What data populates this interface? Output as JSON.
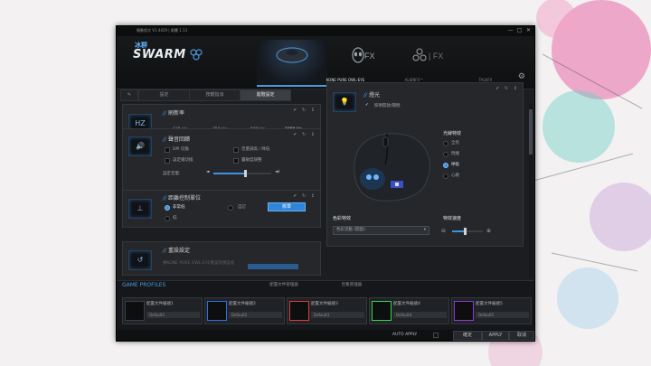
{
  "window": {
    "title": "驅動程式 V1.4429 | 韌體 1.13",
    "controls": [
      "—",
      "□",
      "✕"
    ]
  },
  "brand": {
    "cn": "冰群",
    "name": "SWARM"
  },
  "devices": [
    {
      "label": "KONE PURE OWL-EYE"
    },
    {
      "label": "ALIENFX™"
    },
    {
      "label": "TALKFX"
    }
  ],
  "tabs": [
    "設定",
    "按鍵指派",
    "進階設定"
  ],
  "panels": {
    "polling": {
      "title": "刷新率",
      "options": [
        "125 Hz",
        "250 Hz",
        "500 Hz",
        "1000 Hz"
      ],
      "selected": "1000 Hz",
      "icon_text": "HZ"
    },
    "sound": {
      "title": "聲音回饋",
      "options": [
        "DPI 切換",
        "音量調高 / 降低",
        "設定檔切換",
        "靈敏度調整"
      ],
      "volume_label": "設定音量:"
    },
    "distance": {
      "title": "距離控制單位",
      "options": [
        "非常低",
        "自訂",
        "低"
      ],
      "selected": "非常低",
      "calibrate_label": "校準"
    },
    "reset": {
      "title": "重設設定",
      "desc": "將KONE PURE OWL-EYE重設為預設值"
    },
    "lighting": {
      "title": "燈光",
      "enable_label": "照明開啟/關閉",
      "effects_title": "光線特效",
      "effects": [
        "全亮",
        "閃爍",
        "呼吸",
        "心跳"
      ],
      "selected_effect": "呼吸",
      "color_title": "色彩特效",
      "color_value": "色彩流動 (開啟)",
      "speed_title": "特效速度"
    }
  },
  "profiles": {
    "heading": "GAME PROFILES",
    "tabs": [
      "配置文件管理器",
      "巨集管理器"
    ],
    "slots": [
      {
        "name": "配置文件編號1",
        "default": "Default1"
      },
      {
        "name": "配置文件編號2",
        "default": "Default2"
      },
      {
        "name": "配置文件編號3",
        "default": "Default3"
      },
      {
        "name": "配置文件編號4",
        "default": "Default4"
      },
      {
        "name": "配置文件編號5",
        "default": "Default5"
      }
    ],
    "slot_colors": [
      "#d9d9d9",
      "#2f6fe0",
      "#e03a3a",
      "#38d64a",
      "#8a3ad9"
    ]
  },
  "footer": {
    "auto_apply": "AUTO APPLY",
    "ok": "確定",
    "apply": "APPLY",
    "cancel": "取消"
  },
  "accent": "#3e93e0"
}
